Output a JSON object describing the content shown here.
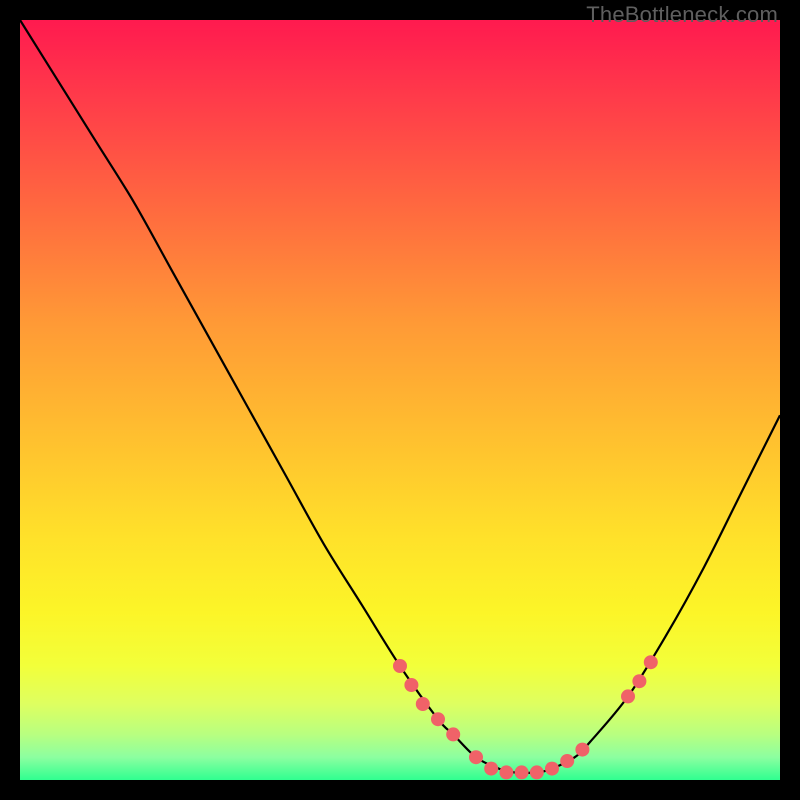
{
  "branding": {
    "text": "TheBottleneck.com"
  },
  "colors": {
    "curve_stroke": "#000000",
    "marker_fill": "#f06268",
    "marker_stroke": "#f06268"
  },
  "chart_data": {
    "type": "line",
    "title": "",
    "xlabel": "",
    "ylabel": "",
    "xlim": [
      0,
      100
    ],
    "ylim": [
      0,
      100
    ],
    "grid": false,
    "legend": false,
    "series": [
      {
        "name": "curve",
        "x": [
          0,
          5,
          10,
          15,
          20,
          25,
          30,
          35,
          40,
          45,
          50,
          55,
          57,
          60,
          63,
          65,
          68,
          70,
          73,
          75,
          80,
          85,
          90,
          95,
          100
        ],
        "y": [
          100,
          92,
          84,
          76,
          67,
          58,
          49,
          40,
          31,
          23,
          15,
          8,
          6,
          3,
          1.5,
          1,
          1,
          1.5,
          3,
          5,
          11,
          19,
          28,
          38,
          48
        ]
      }
    ],
    "markers": [
      {
        "x": 50.0,
        "y": 15.0
      },
      {
        "x": 51.5,
        "y": 12.5
      },
      {
        "x": 53.0,
        "y": 10.0
      },
      {
        "x": 55.0,
        "y": 8.0
      },
      {
        "x": 57.0,
        "y": 6.0
      },
      {
        "x": 60.0,
        "y": 3.0
      },
      {
        "x": 62.0,
        "y": 1.5
      },
      {
        "x": 64.0,
        "y": 1.0
      },
      {
        "x": 66.0,
        "y": 1.0
      },
      {
        "x": 68.0,
        "y": 1.0
      },
      {
        "x": 70.0,
        "y": 1.5
      },
      {
        "x": 72.0,
        "y": 2.5
      },
      {
        "x": 74.0,
        "y": 4.0
      },
      {
        "x": 80.0,
        "y": 11.0
      },
      {
        "x": 81.5,
        "y": 13.0
      },
      {
        "x": 83.0,
        "y": 15.5
      }
    ]
  }
}
